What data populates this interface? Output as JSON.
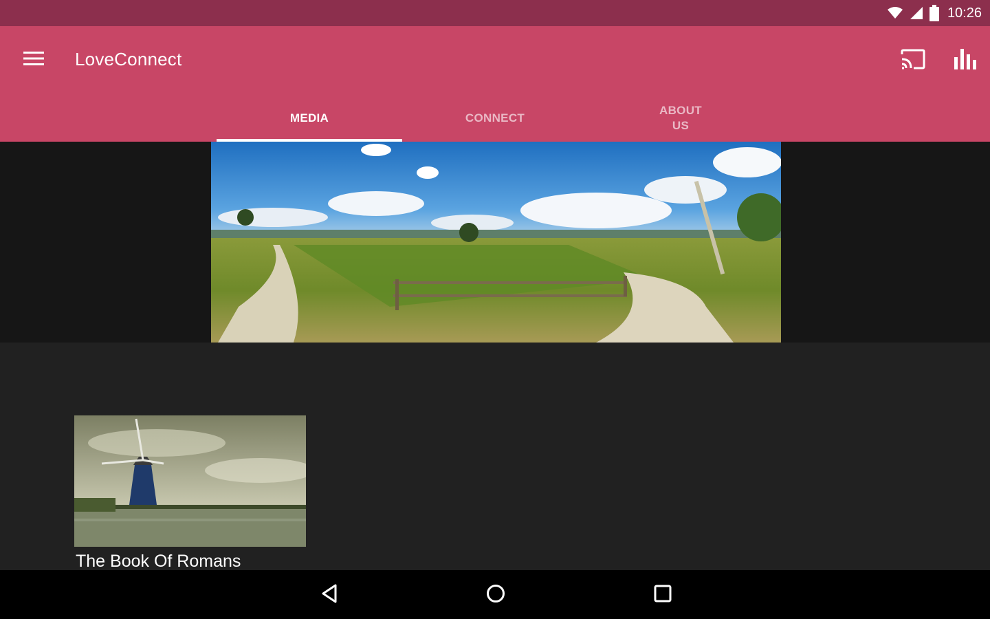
{
  "status_bar": {
    "time": "10:26",
    "icons": [
      "wifi-icon",
      "signal-icon",
      "battery-icon"
    ]
  },
  "app_bar": {
    "title": "LoveConnect",
    "menu_icon": "hamburger-menu-icon",
    "actions": [
      "cast-icon",
      "bar-chart-icon"
    ],
    "color": "#c84666"
  },
  "tabs": [
    {
      "label": "MEDIA",
      "selected": true
    },
    {
      "label": "CONNECT",
      "selected": false
    },
    {
      "label": "ABOUT US",
      "selected": false
    }
  ],
  "banner": {
    "image": "countryside-field-panorama"
  },
  "media_items": [
    {
      "title": "The Book Of Romans",
      "thumbnail": "windmill-by-water"
    }
  ],
  "nav_bar": {
    "buttons": [
      "back-icon",
      "home-icon",
      "recents-icon"
    ]
  },
  "colors": {
    "status_bar": "#8c2f4d",
    "accent": "#c84666",
    "background": "#212121"
  }
}
